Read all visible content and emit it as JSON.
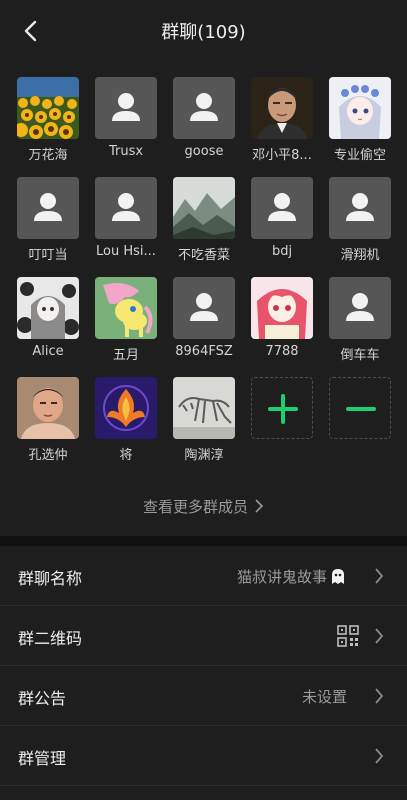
{
  "header": {
    "title": "群聊(109)"
  },
  "members": [
    {
      "name": "万花海",
      "avatar": "sunflower-field"
    },
    {
      "name": "Trusx",
      "avatar": "default-person"
    },
    {
      "name": "goose",
      "avatar": "default-person"
    },
    {
      "name": "邓小平8...",
      "avatar": "portrait-man"
    },
    {
      "name": "专业偷空",
      "avatar": "anime-girl-flowers"
    },
    {
      "name": "叮叮当",
      "avatar": "default-person"
    },
    {
      "name": "Lou Hsi...",
      "avatar": "default-person"
    },
    {
      "name": "不吃香菜",
      "avatar": "misty-mountains"
    },
    {
      "name": "bdj",
      "avatar": "default-person"
    },
    {
      "name": "滑翔机",
      "avatar": "default-person"
    },
    {
      "name": "Alice",
      "avatar": "anime-girl-roses"
    },
    {
      "name": "五月",
      "avatar": "pony-cartoon"
    },
    {
      "name": "8964FSZ",
      "avatar": "default-person"
    },
    {
      "name": "7788",
      "avatar": "anime-girl-red-hair"
    },
    {
      "name": "倒车车",
      "avatar": "default-person"
    },
    {
      "name": "孔选仲",
      "avatar": "photo-man"
    },
    {
      "name": "将",
      "avatar": "phoenix-emblem"
    },
    {
      "name": "陶渊淳",
      "avatar": "dinosaur-skeleton"
    }
  ],
  "actions": {
    "add": "plus-icon",
    "remove": "minus-icon"
  },
  "more_members": "查看更多群成员",
  "settings": {
    "group_name": {
      "label": "群聊名称",
      "value": "猫叔讲鬼故事"
    },
    "qr_code": {
      "label": "群二维码"
    },
    "announcement": {
      "label": "群公告",
      "value": "未设置"
    },
    "management": {
      "label": "群管理"
    }
  },
  "colors": {
    "accent_green": "#1fcf6f",
    "background": "#1e1e1e",
    "default_avatar": "#565656"
  }
}
